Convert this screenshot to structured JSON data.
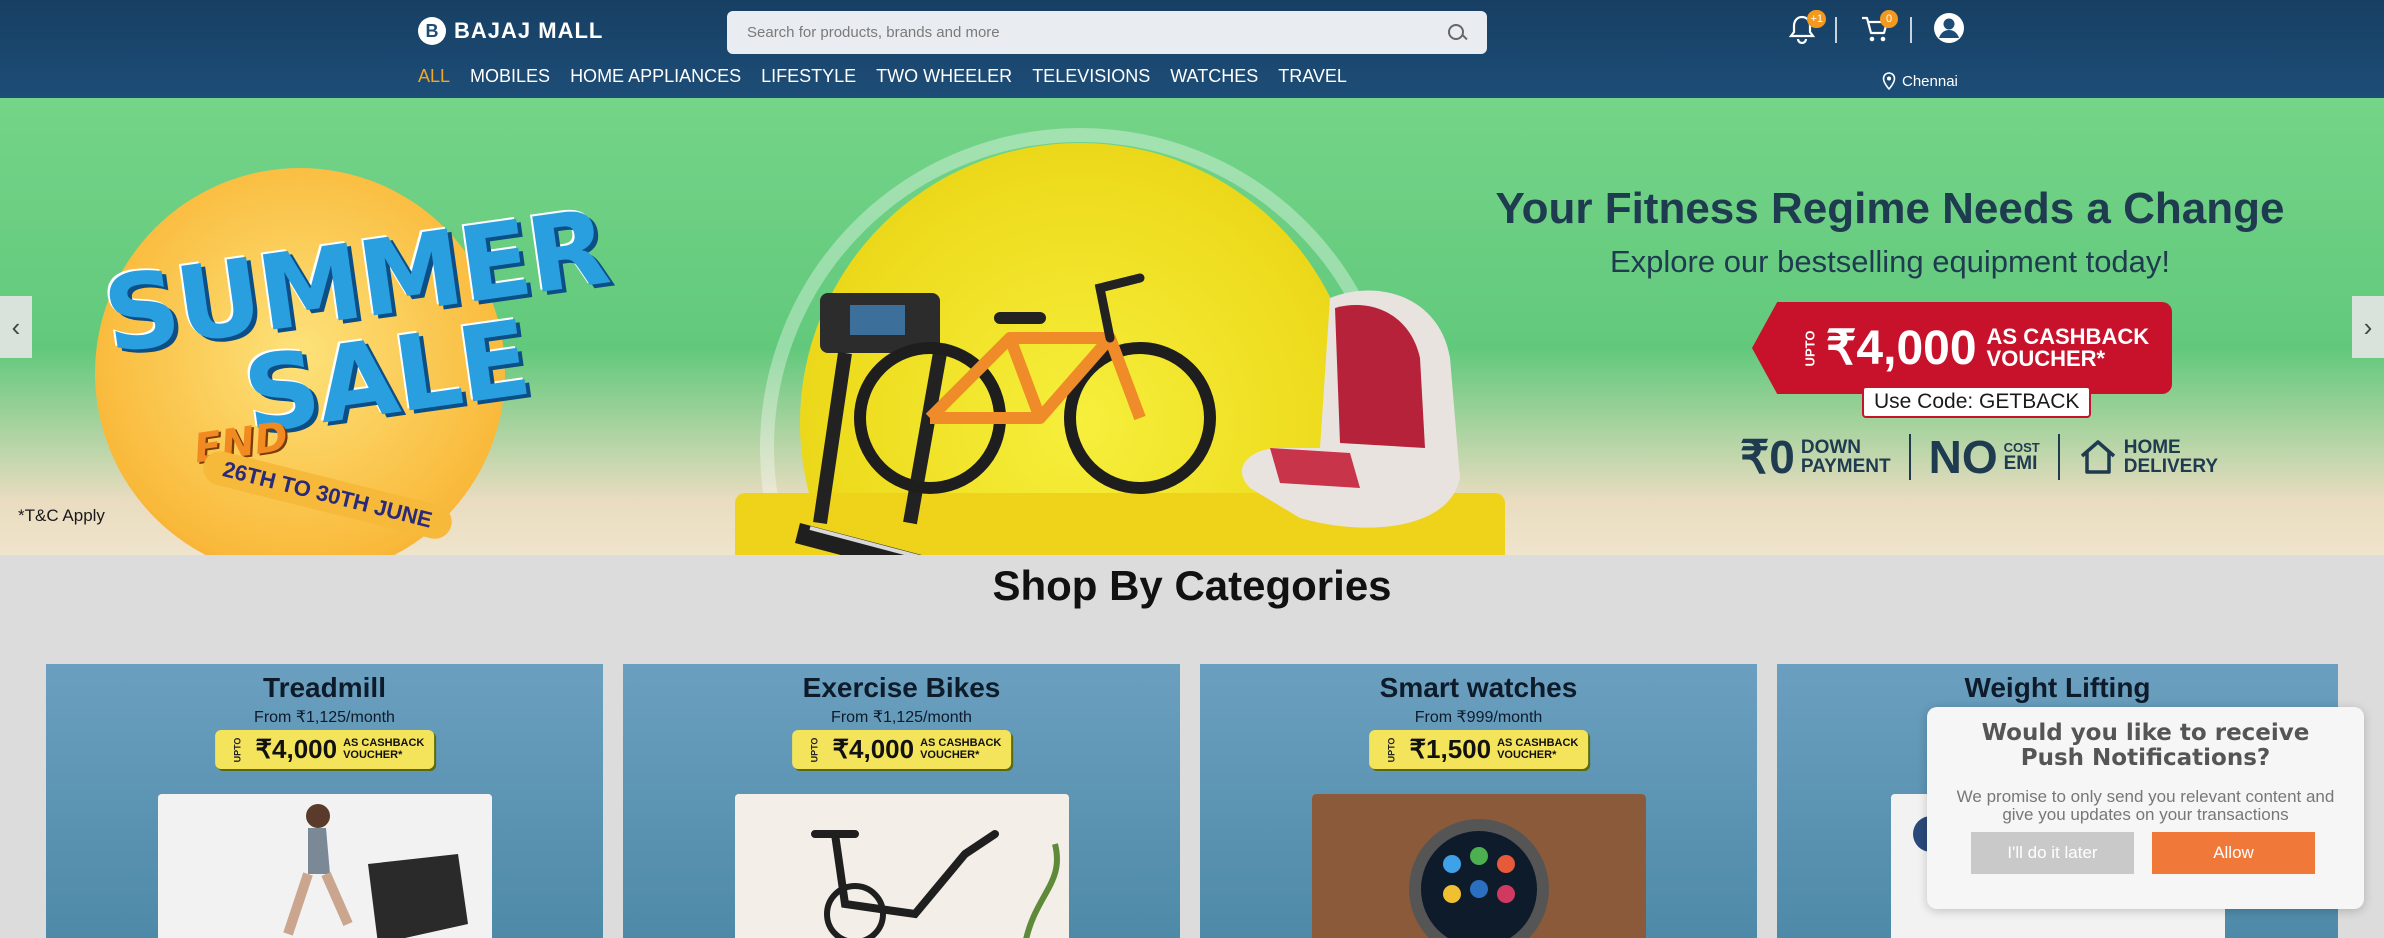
{
  "header": {
    "logo_mark": "B",
    "logo_text": "BAJAJ MALL",
    "search_placeholder": "Search for products, brands and more",
    "notifications_badge": "+1",
    "cart_badge": "0",
    "location": "Chennai"
  },
  "nav": {
    "items": [
      "ALL",
      "MOBILES",
      "HOME APPLIANCES",
      "LIFESTYLE",
      "TWO WHEELER",
      "TELEVISIONS",
      "WATCHES",
      "TRAVEL"
    ],
    "active_index": 0
  },
  "banner": {
    "sale_title": "SUMMER",
    "sale_title_2": "SALE",
    "sale_end": "END",
    "sale_dates": "26TH TO 30TH JUNE",
    "tnc": "*T&C Apply",
    "headline": "Your Fitness Regime Needs a Change",
    "subline": "Explore our bestselling equipment today!",
    "voucher_upto": "UPTO",
    "voucher_amount": "₹4,000",
    "voucher_text_1": "AS CASHBACK",
    "voucher_text_2": "VOUCHER*",
    "code": "Use Code: GETBACK",
    "perk_1_big": "₹0",
    "perk_1_small_1": "DOWN",
    "perk_1_small_2": "PAYMENT",
    "perk_2_big": "NO",
    "perk_2_small_1": "COST",
    "perk_2_small_2": "EMI",
    "perk_3_small_1": "HOME",
    "perk_3_small_2": "DELIVERY",
    "prev_glyph": "‹",
    "next_glyph": "›"
  },
  "categories": {
    "title": "Shop By Categories",
    "cards": [
      {
        "name": "Treadmill",
        "price": "From ₹1,125/month",
        "upto": "UPTO",
        "amount": "₹4,000",
        "v1": "AS CASHBACK",
        "v2": "VOUCHER*"
      },
      {
        "name": "Exercise Bikes",
        "price": "From ₹1,125/month",
        "upto": "UPTO",
        "amount": "₹4,000",
        "v1": "AS CASHBACK",
        "v2": "VOUCHER*"
      },
      {
        "name": "Smart watches",
        "price": "From ₹999/month",
        "upto": "UPTO",
        "amount": "₹1,500",
        "v1": "AS CASHBACK",
        "v2": "VOUCHER*"
      },
      {
        "name": "Weight Lifting"
      }
    ]
  },
  "push_prompt": {
    "title": "Would you like to receive Push Notifications?",
    "body": "We promise to only send you relevant content and give you updates on your transactions",
    "later": "I'll do it later",
    "allow": "Allow"
  },
  "colors": {
    "header_bg": "#1d4d77",
    "active_nav": "#f5a623",
    "badge": "#f39a1e",
    "allow_button": "#f0793a",
    "voucher_red": "#c8122b"
  }
}
